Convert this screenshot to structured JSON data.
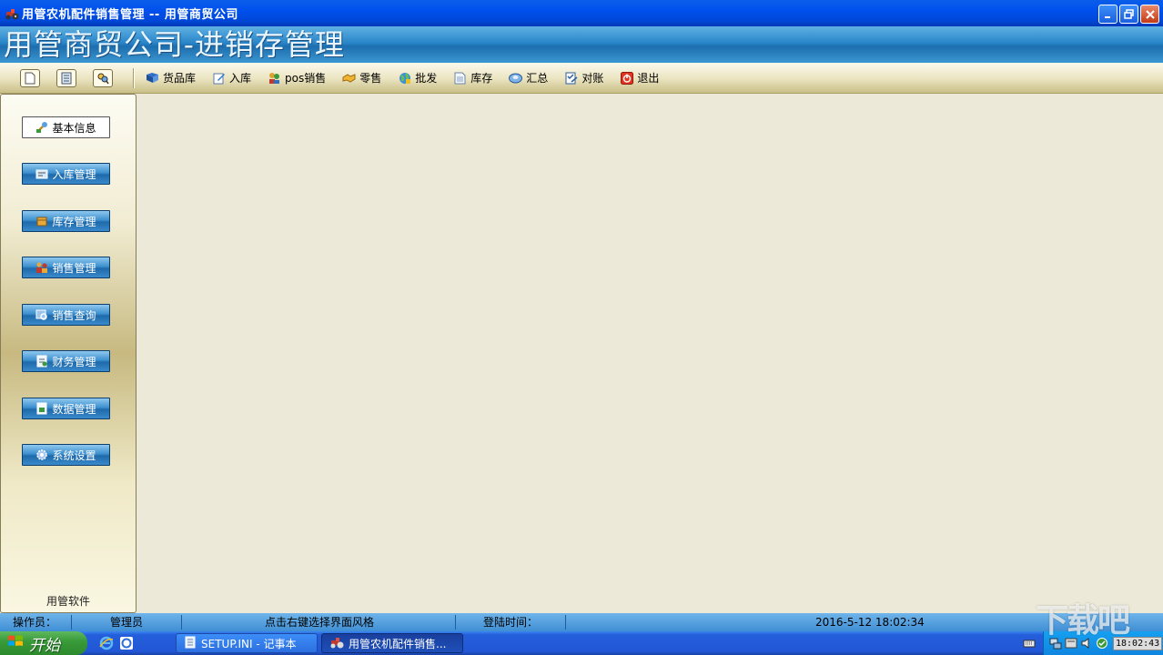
{
  "window": {
    "title": "用管农机配件销售管理  --  用管商贸公司",
    "banner": "用管商贸公司-进销存管理"
  },
  "toolbar": {
    "items": [
      {
        "label": "货品库",
        "icon": "books-icon"
      },
      {
        "label": "入库",
        "icon": "edit-icon"
      },
      {
        "label": "pos销售",
        "icon": "people-icon"
      },
      {
        "label": "零售",
        "icon": "handshake-icon"
      },
      {
        "label": "批发",
        "icon": "globe-icon"
      },
      {
        "label": "库存",
        "icon": "document-icon"
      },
      {
        "label": "汇总",
        "icon": "disk-icon"
      },
      {
        "label": "对账",
        "icon": "checklist-icon"
      },
      {
        "label": "退出",
        "icon": "power-icon"
      }
    ]
  },
  "sidebar": {
    "buttons": [
      {
        "label": "基本信息",
        "active": true
      },
      {
        "label": "入库管理"
      },
      {
        "label": "库存管理"
      },
      {
        "label": "销售管理"
      },
      {
        "label": "销售查询"
      },
      {
        "label": "财务管理"
      },
      {
        "label": "数据管理"
      },
      {
        "label": "系统设置"
      }
    ],
    "footer": "用管软件"
  },
  "status": {
    "operator_label": "操作员：",
    "operator": "管理员",
    "hint": "点击右键选择界面风格",
    "login_label": "登陆时间：",
    "datetime": "2016-5-12 18:02:34"
  },
  "taskbar": {
    "start": "开始",
    "tasks": [
      "SETUP.INI - 记事本",
      "用管农机配件销售..."
    ],
    "clock": "18:02:43"
  },
  "watermark": "下载吧",
  "colors": {
    "title_blue": "#0050ee",
    "banner_blue": "#2a86c9",
    "workspace": "#ece9d8",
    "start_green": "#3a9b3a"
  }
}
